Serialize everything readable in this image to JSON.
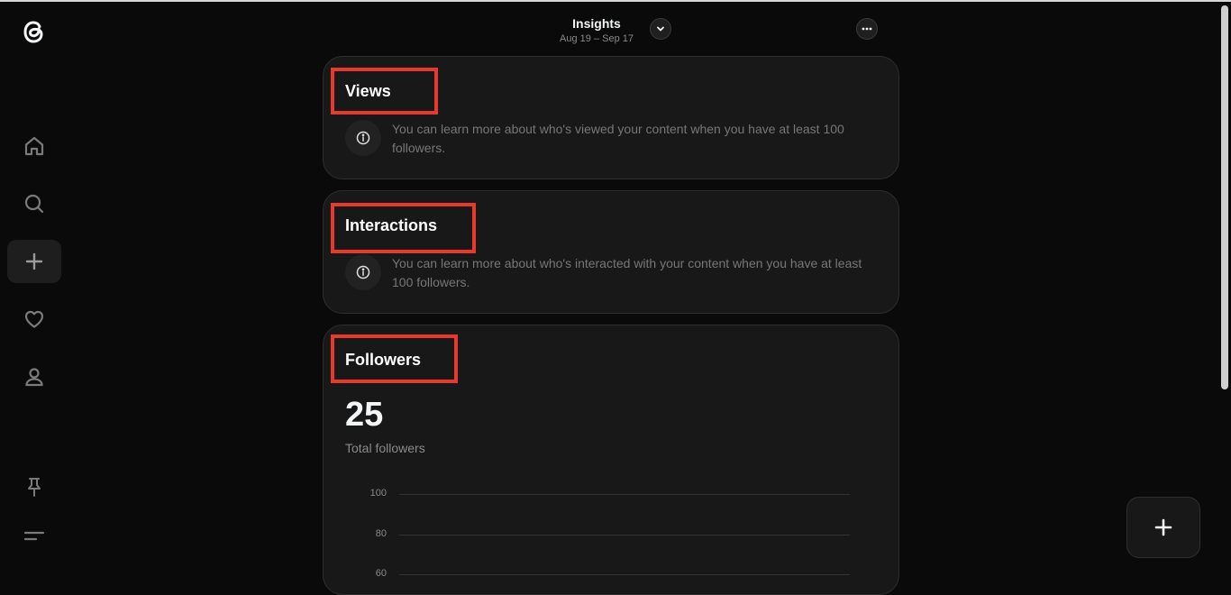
{
  "header": {
    "title": "Insights",
    "date_range": "Aug 19 – Sep 17"
  },
  "icons": {
    "logo": "threads-logo-icon",
    "nav": [
      "home-icon",
      "search-icon",
      "plus-icon",
      "heart-icon",
      "profile-icon"
    ],
    "bottom": [
      "pin-icon",
      "menu-icon"
    ],
    "header": [
      "chevron-down-icon",
      "more-options-icon"
    ],
    "fab": "plus-icon"
  },
  "views": {
    "title": "Views",
    "info": "You can learn more about who's viewed your content when you have at least 100 followers."
  },
  "interactions": {
    "title": "Interactions",
    "info": "You can learn more about who's interacted with your content when you have at least 100 followers."
  },
  "followers": {
    "title": "Followers",
    "count": "25",
    "count_label": "Total followers"
  },
  "chart_data": {
    "type": "line",
    "title": "",
    "xlabel": "",
    "ylabel": "",
    "y_ticks": [
      "100",
      "80",
      "60"
    ],
    "ylim": [
      0,
      100
    ],
    "grid": true,
    "series": []
  },
  "colors": {
    "highlight": "#e8392f",
    "background": "#0a0a0a",
    "card": "#181818"
  }
}
